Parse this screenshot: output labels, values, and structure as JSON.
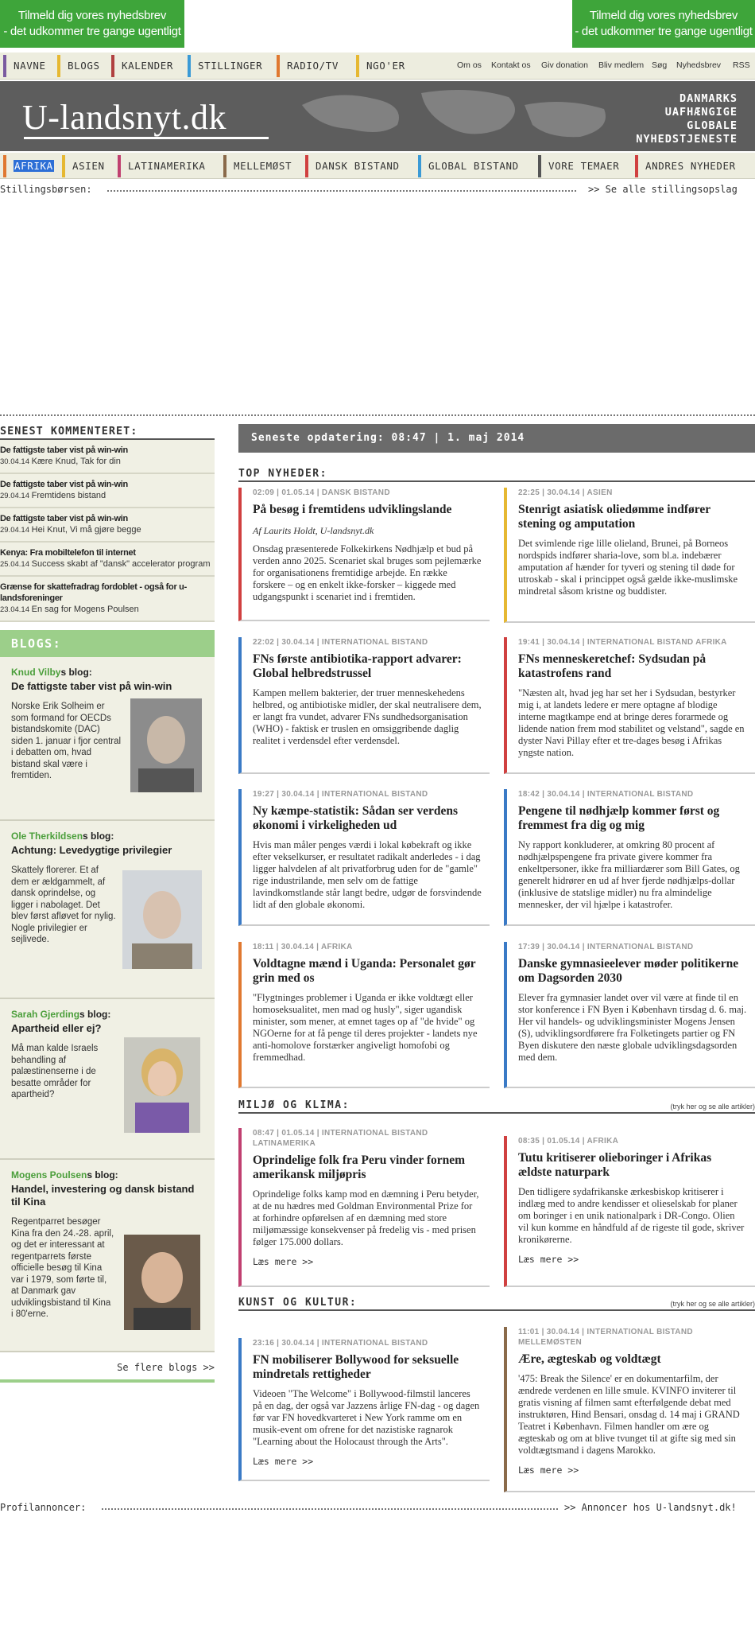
{
  "banners": {
    "left_line1": "Tilmeld dig vores nyhedsbrev",
    "left_line2": "- det udkommer tre gange ugentligt",
    "right_line1": "Tilmeld dig vores nyhedsbrev",
    "right_line2": "- det udkommer tre gange ugentligt"
  },
  "nav_top": {
    "items": [
      "NAVNE",
      "BLOGS",
      "KALENDER",
      "STILLINGER",
      "RADIO/TV",
      "NGO'ER"
    ],
    "colors": [
      "#7a5aa0",
      "#e6b832",
      "#b04040",
      "#3a9ad6",
      "#e07830",
      "#e6b832"
    ],
    "right_links": [
      "Om os",
      "Kontakt os",
      "Giv donation",
      "Bliv medlem",
      "Søg",
      "Nyhedsbrev",
      "RSS"
    ]
  },
  "masthead": {
    "logo": "U-landsnyt.dk",
    "tagline": [
      "DANMARKS",
      "UAFHÆNGIGE",
      "GLOBALE",
      "NYHEDSTJENESTE"
    ]
  },
  "nav_main": {
    "items": [
      "AFRIKA",
      "ASIEN",
      "LATINAMERIKA",
      "MELLEMØST",
      "DANSK BISTAND",
      "GLOBAL BISTAND",
      "VORE TEMAER",
      "ANDRES NYHEDER"
    ],
    "colors": [
      "#e07830",
      "#e6b832",
      "#c04070",
      "#8a6a4a",
      "#d04040",
      "#3a9ad6",
      "#555555",
      "#d04040"
    ],
    "selected": "AFRIKA"
  },
  "stillings": {
    "label": "Stillingsbørsen:",
    "link": ">> Se alle stillingsopslag"
  },
  "latest_comments": {
    "heading": "SENEST KOMMENTERET:",
    "items": [
      {
        "title": "De fattigste taber vist på win-win",
        "date": "30.04.14",
        "text": "Kære Knud, Tak for din"
      },
      {
        "title": "De fattigste taber vist på win-win",
        "date": "29.04.14",
        "text": "Fremtidens bistand"
      },
      {
        "title": "De fattigste taber vist på win-win",
        "date": "29.04.14",
        "text": "Hei Knut, Vi må gjøre begge"
      },
      {
        "title": "Kenya: Fra mobiltelefon til internet",
        "date": "25.04.14",
        "text": "Success skabt af \"dansk\" accelerator program"
      },
      {
        "title": "Grænse for skattefradrag fordoblet - også for u-landsforeninger",
        "date": "23.04.14",
        "text": "En sag for Mogens Poulsen"
      }
    ]
  },
  "blogs": {
    "heading": "BLOGS:",
    "items": [
      {
        "author_green": "Knud Vilby",
        "author_rest": "s blog:",
        "title": "De fattigste taber vist på win-win",
        "text": "Norske Erik Solheim er som formand for OECDs bistandskomite (DAC) siden 1. januar i fjor central i debatten om, hvad bistand skal være i fremtiden."
      },
      {
        "author_green": "Ole Therkildsen",
        "author_rest": "s blog:",
        "title": "Achtung: Levedygtige privilegier",
        "text": "Skattely florerer. Et af dem er ældgammelt, af dansk oprindelse, og ligger i nabolaget. Det blev først afløvet for nylig. Nogle privilegier er sejlivede."
      },
      {
        "author_green": "Sarah Gjerding",
        "author_rest": "s blog:",
        "title": "Apartheid eller ej?",
        "text": "Må man kalde Israels behandling af palæstinenserne i de besatte områder for apartheid?"
      },
      {
        "author_green": "Mogens Poulsen",
        "author_rest": "s blog:",
        "title": "Handel, investering og dansk bistand til Kina",
        "text": "Regentparret besøger Kina fra den 24.-28. april, og det er interessant at regentparrets første officielle besøg til Kina var i 1979, som førte til, at Danmark gav udviklingsbistand til Kina i 80'erne."
      }
    ],
    "more": "Se flere blogs >>"
  },
  "update": {
    "text": "Seneste opdatering: 08:47 | 1. maj 2014"
  },
  "sections": {
    "top": "TOP NYHEDER:",
    "miljo": "MILJØ OG KLIMA:",
    "miljo_right": "(tryk her og se alle artikler)",
    "kunst": "KUNST OG KULTUR:",
    "kunst_right": "(tryk her og se alle artikler)"
  },
  "articles": {
    "a1": {
      "meta": "02:09 | 01.05.14 | DANSK BISTAND",
      "title": "På besøg i fremtidens udviklingslande",
      "author": "Af Laurits Holdt, U-landsnyt.dk",
      "body": "Onsdag præsenterede Folkekirkens Nødhjælp et bud på verden anno 2025. Scenariet skal bruges som pejlemærke for organisationens fremtidige arbejde. En række forskere – og en enkelt ikke-forsker – kiggede med udgangspunkt i scenariet ind i fremtiden.",
      "color": "#d04040"
    },
    "a2": {
      "meta": "22:25 | 30.04.14 | ASIEN",
      "title": "Stenrigt asiatisk oliedømme indfører stening og amputation",
      "body": "Det svimlende rige lille olieland, Brunei, på Borneos nordspids indfører sharia-love, som bl.a. indebærer amputation af hænder for tyveri og stening til døde for utroskab - skal i princippet også gælde ikke-muslimske mindretal såsom kristne og buddister.",
      "color": "#e6b832"
    },
    "a3": {
      "meta": "22:02 | 30.04.14 | INTERNATIONAL BISTAND",
      "title": "FNs første antibiotika-rapport advarer: Global helbredstrussel",
      "body": "Kampen mellem bakterier, der truer menneskehedens helbred, og antibiotiske midler, der skal neutralisere dem, er langt fra vundet, advarer FNs sundhedsorganisation (WHO) - faktisk er truslen en omsiggribende daglig realitet i verdensdel efter verdensdel.",
      "color": "#3a7ac6"
    },
    "a4": {
      "meta": "19:41 | 30.04.14 | INTERNATIONAL BISTAND  AFRIKA",
      "title": "FNs menneskeretchef: Sydsudan på katastrofens rand",
      "body": "\"Næsten alt, hvad jeg har set her i Sydsudan, bestyrker mig i, at landets ledere er mere optagne af blodige interne magtkampe end at bringe deres forarmede og lidende nation frem mod stabilitet og velstand\", sagde en dyster Navi Pillay efter et tre-dages besøg i Afrikas yngste nation.",
      "color": "#d04040"
    },
    "a5": {
      "meta": "19:27 | 30.04.14 | INTERNATIONAL BISTAND",
      "title": "Ny kæmpe-statistik: Sådan ser verdens økonomi i virkeligheden ud",
      "body": "Hvis man måler penges værdi i lokal købekraft og ikke efter vekselkurser, er resultatet radikalt anderledes - i dag ligger halvdelen af alt privatforbrug uden for de \"gamle\" rige industrilande, men selv om de fattige lavindkomstlande står langt bedre, udgør de forsvindende lidt af den globale økonomi.",
      "color": "#3a7ac6"
    },
    "a6": {
      "meta": "18:42 | 30.04.14 | INTERNATIONAL BISTAND",
      "title": "Pengene til nødhjælp kommer først og fremmest fra dig og mig",
      "body": "Ny rapport konkluderer, at omkring 80 procent af nødhjælpspengene fra private givere kommer fra enkeltpersoner, ikke fra milliardærer som Bill Gates, og generelt hidrører en ud af hver fjerde nødhjælps-dollar (inklusive de statslige midler) nu fra almindelige mennesker, der vil hjælpe i katastrofer.",
      "color": "#3a7ac6"
    },
    "a7": {
      "meta": "18:11 | 30.04.14 | AFRIKA",
      "title": "Voldtagne mænd i Uganda: Personalet gør grin med os",
      "body": "\"Flygtninges problemer i Uganda er ikke voldtægt eller homoseksualitet, men mad og husly\", siger ugandisk minister, som mener, at emnet tages op af \"de hvide\" og NGOerne for at få penge til deres projekter - landets nye anti-homolove forstærker angiveligt homofobi og fremmedhad.",
      "color": "#e07830"
    },
    "a8": {
      "meta": "17:39 | 30.04.14 | INTERNATIONAL BISTAND",
      "title": "Danske gymnasieelever møder politikerne om Dagsorden 2030",
      "body": "Elever fra gymnasier landet over vil være at finde til en stor konference i FN Byen i København tirsdag d. 6. maj. Her vil handels- og udviklingsminister Mogens Jensen (S), udviklingsordførere fra Folketingets partier og FN Byen diskutere den næste globale udviklingsdagsorden med dem.",
      "color": "#3a7ac6"
    },
    "m1": {
      "meta": "08:47 | 01.05.14 | INTERNATIONAL BISTAND",
      "meta2": "LATINAMERIKA",
      "title": "Oprindelige folk fra Peru vinder fornem amerikansk miljøpris",
      "body": "Oprindelige folks kamp mod en dæmning i Peru betyder, at de nu hædres med Goldman Environmental Prize for at forhindre opførelsen af en dæmning med store miljømæssige konsekvenser på fredelig vis - med prisen følger 175.000 dollars.",
      "more": "Læs mere >>",
      "color": "#c04070"
    },
    "m2": {
      "meta": "08:35 | 01.05.14 | AFRIKA",
      "title": "Tutu kritiserer olieboringer i Afrikas ældste naturpark",
      "body": "Den tidligere sydafrikanske ærkesbiskop kritiserer i indlæg med to andre kendisser et olieselskab for planer om boringer i en unik nationalpark i DR-Congo. Olien vil kun komme en håndfuld af de rigeste til gode, skriver kronikørerne.",
      "more": "Læs mere >>",
      "color": "#d04040"
    },
    "k1": {
      "meta": "23:16 | 30.04.14 | INTERNATIONAL BISTAND",
      "title": "FN mobiliserer Bollywood for seksuelle mindretals rettigheder",
      "body": "Videoen \"The Welcome\" i Bollywood-filmstil lanceres på en dag, der også var Jazzens årlige FN-dag - og dagen før var FN hovedkvarteret i New York ramme om en musik-event om ofrene for det nazistiske ragnarok \"Learning about the Holocaust through the Arts\".",
      "more": "Læs mere >>",
      "color": "#3a7ac6"
    },
    "k2": {
      "meta": "11:01 | 30.04.14 | INTERNATIONAL BISTAND",
      "meta2": "MELLEMØSTEN",
      "title": "Ære, ægteskab og voldtægt",
      "body": "'475: Break the Silence' er en dokumentarfilm, der ændrede verdenen en lille smule. KVINFO inviterer til gratis visning af filmen samt efterfølgende debat med instruktøren, Hind Bensari, onsdag d. 14 maj i GRAND Teatret i København. Filmen handler om ære og ægteskab og om at blive tvunget til at gifte sig med sin voldtægtsmand i dagens Marokko.",
      "more": "Læs mere >>",
      "color": "#8a6a4a"
    }
  },
  "profil": {
    "label": "Profilannoncer:",
    "link": ">> Annoncer hos U-landsnyt.dk!"
  }
}
